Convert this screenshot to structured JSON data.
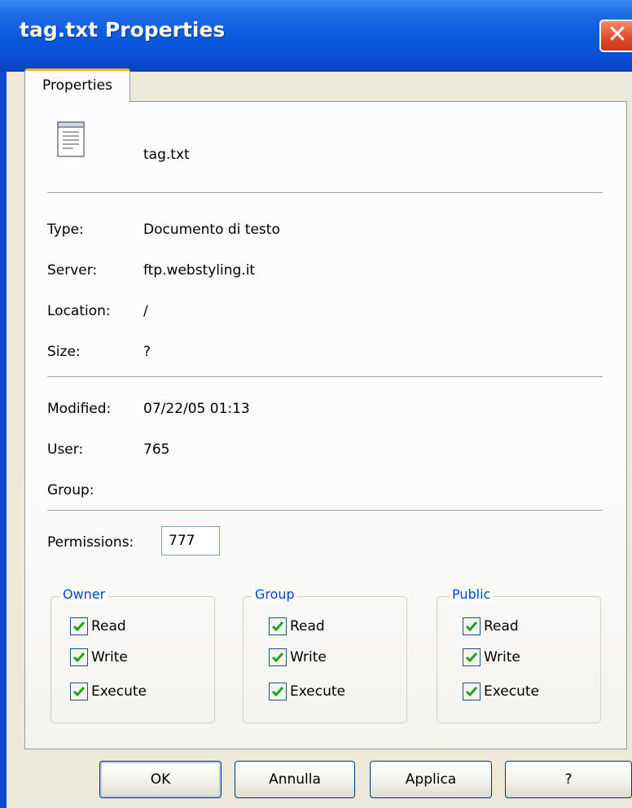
{
  "window": {
    "title": "tag.txt Properties",
    "close_glyph": "✕"
  },
  "tabs": [
    {
      "label": "Properties",
      "active": true
    }
  ],
  "file": {
    "icon": "text-document-icon",
    "name": "tag.txt"
  },
  "info": [
    {
      "label": "Type:",
      "value": "Documento di testo"
    },
    {
      "label": "Server:",
      "value": "ftp.webstyling.it"
    },
    {
      "label": "Location:",
      "value": "/"
    },
    {
      "label": "Size:",
      "value": "?"
    }
  ],
  "meta": [
    {
      "label": "Modified:",
      "value": "07/22/05 01:13"
    },
    {
      "label": "User:",
      "value": "765"
    },
    {
      "label": "Group:",
      "value": ""
    }
  ],
  "permissions": {
    "label": "Permissions:",
    "value": "777",
    "groups": [
      {
        "title": "Owner",
        "read": "Read",
        "write": "Write",
        "execute": "Execute",
        "checked": [
          true,
          true,
          true
        ]
      },
      {
        "title": "Group",
        "read": "Read",
        "write": "Write",
        "execute": "Execute",
        "checked": [
          true,
          true,
          true
        ]
      },
      {
        "title": "Public",
        "read": "Read",
        "write": "Write",
        "execute": "Execute",
        "checked": [
          true,
          true,
          true
        ]
      }
    ]
  },
  "buttons": {
    "ok": "OK",
    "cancel": "Annulla",
    "apply": "Applica",
    "help": "?"
  },
  "colors": {
    "titlebar": "#0a58de",
    "group_title": "#0046d5",
    "checkmark": "#21a121"
  }
}
